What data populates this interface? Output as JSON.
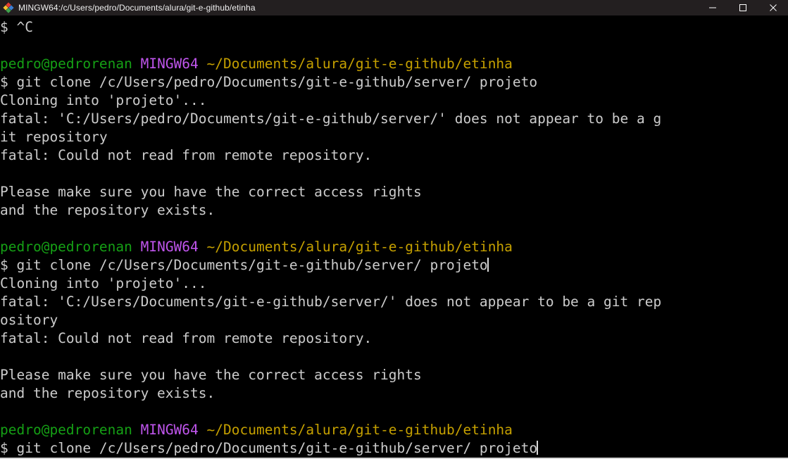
{
  "window": {
    "title": "MINGW64:/c/Users/pedro/Documents/alura/git-e-github/etinha",
    "icon_name": "mingw-diamond-icon",
    "controls": {
      "minimize_label": "Minimize",
      "maximize_label": "Maximize",
      "close_label": "Close"
    },
    "colors": {
      "titlebar_bg": "#231f20",
      "titlebar_fg": "#f0f0f0",
      "terminal_bg": "#000000",
      "text_default": "#cccccc",
      "user_green": "#15a015",
      "mingw_magenta": "#bf55ec",
      "path_yellow": "#c5a000",
      "bottom_border": "#d7d7d7"
    }
  },
  "terminal": {
    "prompt_symbol": "$",
    "user_host": "pedro@pedrorenan",
    "shell_name": "MINGW64",
    "cwd": "~/Documents/alura/git-e-github/etinha",
    "lines": [
      {
        "type": "command",
        "prompt": "$",
        "text": " ^C"
      },
      {
        "type": "blank",
        "text": ""
      },
      {
        "type": "prompt",
        "user": "pedro@pedrorenan",
        "shell": "MINGW64",
        "path": "~/Documents/alura/git-e-github/etinha"
      },
      {
        "type": "command",
        "prompt": "$",
        "text": " git clone /c/Users/pedro/Documents/git-e-github/server/ projeto"
      },
      {
        "type": "output",
        "text": "Cloning into 'projeto'..."
      },
      {
        "type": "output",
        "text": "fatal: 'C:/Users/pedro/Documents/git-e-github/server/' does not appear to be a g"
      },
      {
        "type": "output",
        "text": "it repository"
      },
      {
        "type": "output",
        "text": "fatal: Could not read from remote repository."
      },
      {
        "type": "blank",
        "text": ""
      },
      {
        "type": "output",
        "text": "Please make sure you have the correct access rights"
      },
      {
        "type": "output",
        "text": "and the repository exists."
      },
      {
        "type": "blank",
        "text": ""
      },
      {
        "type": "prompt",
        "user": "pedro@pedrorenan",
        "shell": "MINGW64",
        "path": "~/Documents/alura/git-e-github/etinha"
      },
      {
        "type": "command",
        "prompt": "$",
        "text": " git clone /c/Users/Documents/git-e-github/server/ projeto",
        "cursor": true
      },
      {
        "type": "output",
        "text": "Cloning into 'projeto'..."
      },
      {
        "type": "output",
        "text": "fatal: 'C:/Users/Documents/git-e-github/server/' does not appear to be a git rep"
      },
      {
        "type": "output",
        "text": "ository"
      },
      {
        "type": "output",
        "text": "fatal: Could not read from remote repository."
      },
      {
        "type": "blank",
        "text": ""
      },
      {
        "type": "output",
        "text": "Please make sure you have the correct access rights"
      },
      {
        "type": "output",
        "text": "and the repository exists."
      },
      {
        "type": "blank",
        "text": ""
      },
      {
        "type": "prompt",
        "user": "pedro@pedrorenan",
        "shell": "MINGW64",
        "path": "~/Documents/alura/git-e-github/etinha"
      },
      {
        "type": "command",
        "prompt": "$",
        "text": " git clone /c/Users/pedro/Documents/git-e-github/server/ projeto",
        "cursor": true
      }
    ]
  }
}
